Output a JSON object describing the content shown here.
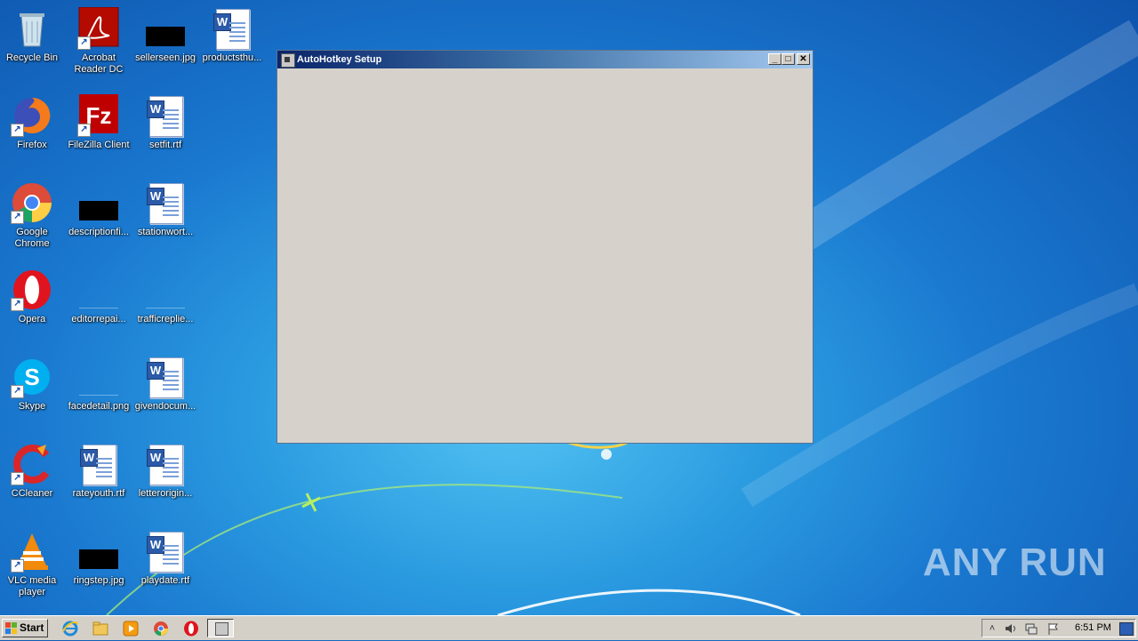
{
  "desktop": {
    "icons": [
      {
        "label": "Recycle Bin",
        "icon": "recycle-bin-icon"
      },
      {
        "label": "Acrobat Reader DC",
        "icon": "acrobat-icon"
      },
      {
        "label": "sellerseen.jpg",
        "icon": "image-file-icon"
      },
      {
        "label": "productsthu...",
        "icon": "word-document-icon"
      },
      {
        "label": "Firefox",
        "icon": "firefox-icon"
      },
      {
        "label": "FileZilla Client",
        "icon": "filezilla-icon"
      },
      {
        "label": "setfit.rtf",
        "icon": "word-document-icon"
      },
      {
        "label": "Google Chrome",
        "icon": "chrome-icon"
      },
      {
        "label": "descriptionfi...",
        "icon": "image-file-icon"
      },
      {
        "label": "stationwort...",
        "icon": "word-document-icon"
      },
      {
        "label": "Opera",
        "icon": "opera-icon"
      },
      {
        "label": "editorrepai...",
        "icon": "image-file-icon"
      },
      {
        "label": "trafficreplie...",
        "icon": "image-file-icon"
      },
      {
        "label": "Skype",
        "icon": "skype-icon"
      },
      {
        "label": "facedetail.png",
        "icon": "image-file-icon"
      },
      {
        "label": "givendocum...",
        "icon": "word-document-icon"
      },
      {
        "label": "CCleaner",
        "icon": "ccleaner-icon"
      },
      {
        "label": "rateyouth.rtf",
        "icon": "word-document-icon"
      },
      {
        "label": "letterorigin...",
        "icon": "word-document-icon"
      },
      {
        "label": "VLC media player",
        "icon": "vlc-icon"
      },
      {
        "label": "ringstep.jpg",
        "icon": "image-file-icon"
      },
      {
        "label": "playdate.rtf",
        "icon": "word-document-icon"
      }
    ]
  },
  "window": {
    "title": "AutoHotkey Setup",
    "minimize_label": "_",
    "maximize_label": "□",
    "close_label": "✕"
  },
  "taskbar": {
    "start_label": "Start",
    "quick_launch": [
      "internet-explorer-icon",
      "folder-icon",
      "media-player-icon",
      "chrome-icon",
      "opera-icon"
    ],
    "task_icon": "autohotkey-setup-icon",
    "tray": {
      "show_hidden_label": "˄",
      "clock": "6:51 PM"
    }
  },
  "watermark": "ANY RUN"
}
